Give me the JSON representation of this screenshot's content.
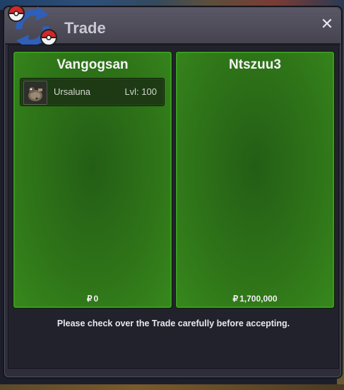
{
  "window": {
    "title": "Trade",
    "close_icon": "close-icon"
  },
  "left_panel": {
    "player": "Vangogsan",
    "pokemon": [
      {
        "name": "Ursaluna",
        "level": "Lvl: 100",
        "icon": "ursaluna-sprite-icon"
      }
    ],
    "money_symbol": "₽",
    "money": "0"
  },
  "right_panel": {
    "player": "Ntszuu3",
    "money_symbol": "₽",
    "money": "1,700,000"
  },
  "notice": "Please check over the Trade carefully before accepting.",
  "colors": {
    "panel_green": "#2e7318",
    "window_bg": "#2e2d3a",
    "titlebar": "#4e4c58"
  }
}
